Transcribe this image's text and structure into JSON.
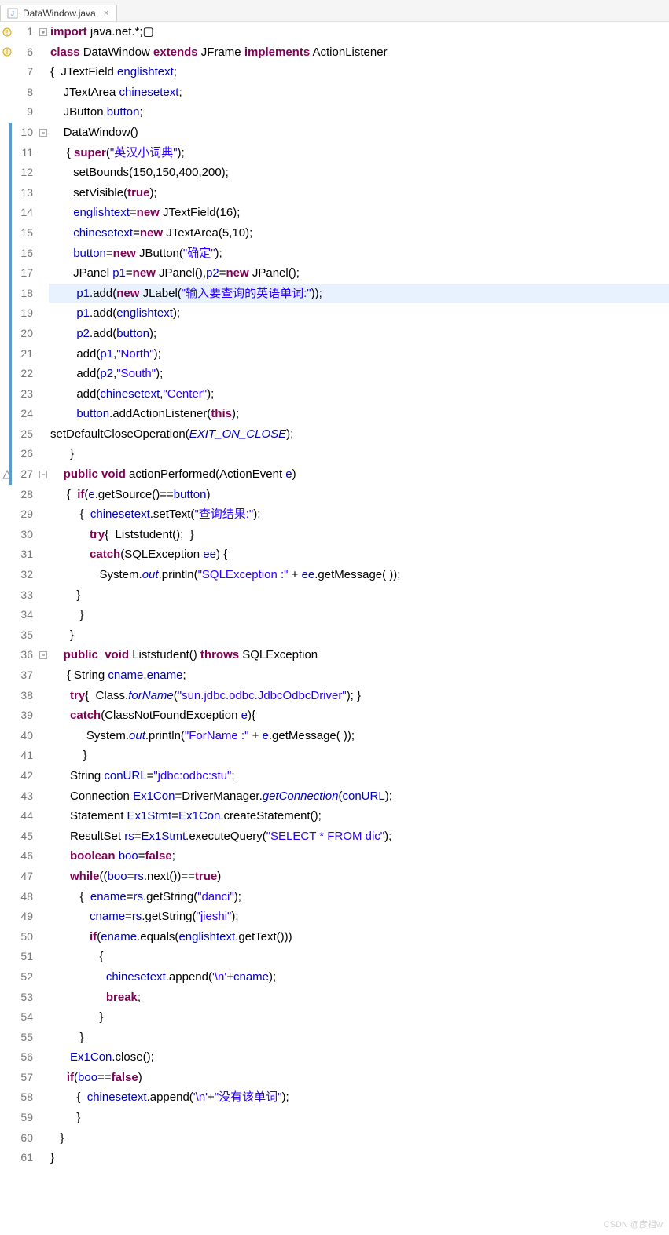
{
  "tab": {
    "filename": "DataWindow.java",
    "close": "×"
  },
  "gutter_icons": {
    "warning": "⚠",
    "fold_plus": "⊕",
    "fold_minus": "⊖",
    "override": "△"
  },
  "lines": [
    {
      "n": 1,
      "g": "warning",
      "f": "plus",
      "changed": false,
      "hl": false,
      "html": "<span class='kw'>import</span> java.net.*;▢"
    },
    {
      "n": 6,
      "g": "warning",
      "f": "",
      "changed": false,
      "hl": false,
      "html": "<span class='kw'>class</span> DataWindow <span class='kw'>extends</span> JFrame <span class='kw'>implements</span> ActionListener"
    },
    {
      "n": 7,
      "g": "",
      "f": "",
      "changed": false,
      "hl": false,
      "html": "{  JTextField <span class='field'>englishtext</span>;"
    },
    {
      "n": 8,
      "g": "",
      "f": "",
      "changed": false,
      "hl": false,
      "html": "    JTextArea <span class='field'>chinesetext</span>;"
    },
    {
      "n": 9,
      "g": "",
      "f": "",
      "changed": false,
      "hl": false,
      "html": "    JButton <span class='field'>button</span>;"
    },
    {
      "n": 10,
      "g": "",
      "f": "minus",
      "changed": true,
      "hl": false,
      "html": "    DataWindow()"
    },
    {
      "n": 11,
      "g": "",
      "f": "",
      "changed": true,
      "hl": false,
      "html": "     { <span class='kw'>super</span>(<span class='str'>\"英汉小词典\"</span>);"
    },
    {
      "n": 12,
      "g": "",
      "f": "",
      "changed": true,
      "hl": false,
      "html": "       setBounds(150,150,400,200);"
    },
    {
      "n": 13,
      "g": "",
      "f": "",
      "changed": true,
      "hl": false,
      "html": "       setVisible(<span class='kw'>true</span>);"
    },
    {
      "n": 14,
      "g": "",
      "f": "",
      "changed": true,
      "hl": false,
      "html": "       <span class='field'>englishtext</span>=<span class='kw'>new</span> JTextField(16);"
    },
    {
      "n": 15,
      "g": "",
      "f": "",
      "changed": true,
      "hl": false,
      "html": "       <span class='field'>chinesetext</span>=<span class='kw'>new</span> JTextArea(5,10);"
    },
    {
      "n": 16,
      "g": "",
      "f": "",
      "changed": true,
      "hl": false,
      "html": "       <span class='field'>button</span>=<span class='kw'>new</span> JButton(<span class='str'>\"确定\"</span>);"
    },
    {
      "n": 17,
      "g": "",
      "f": "",
      "changed": true,
      "hl": false,
      "html": "       JPanel <span class='field'>p1</span>=<span class='kw'>new</span> JPanel(),<span class='field'>p2</span>=<span class='kw'>new</span> JPanel();"
    },
    {
      "n": 18,
      "g": "",
      "f": "",
      "changed": true,
      "hl": true,
      "html": "        <span class='field'>p1</span>.add(<span class='kw'>new</span> JLabel(<span class='str'>\"输入要查询的英语单词:\"</span>));"
    },
    {
      "n": 19,
      "g": "",
      "f": "",
      "changed": true,
      "hl": false,
      "html": "        <span class='field'>p1</span>.add(<span class='field'>englishtext</span>);"
    },
    {
      "n": 20,
      "g": "",
      "f": "",
      "changed": true,
      "hl": false,
      "html": "        <span class='field'>p2</span>.add(<span class='field'>button</span>);"
    },
    {
      "n": 21,
      "g": "",
      "f": "",
      "changed": true,
      "hl": false,
      "html": "        add(<span class='field'>p1</span>,<span class='str'>\"North\"</span>);"
    },
    {
      "n": 22,
      "g": "",
      "f": "",
      "changed": true,
      "hl": false,
      "html": "        add(<span class='field'>p2</span>,<span class='str'>\"South\"</span>);"
    },
    {
      "n": 23,
      "g": "",
      "f": "",
      "changed": true,
      "hl": false,
      "html": "        add(<span class='field'>chinesetext</span>,<span class='str'>\"Center\"</span>);"
    },
    {
      "n": 24,
      "g": "",
      "f": "",
      "changed": true,
      "hl": false,
      "html": "        <span class='field'>button</span>.addActionListener(<span class='kw'>this</span>);"
    },
    {
      "n": 25,
      "g": "",
      "f": "",
      "changed": true,
      "hl": false,
      "html": "setDefaultCloseOperation(<span class='cstat'>EXIT_ON_CLOSE</span>);"
    },
    {
      "n": 26,
      "g": "",
      "f": "",
      "changed": true,
      "hl": false,
      "html": "      }"
    },
    {
      "n": 27,
      "g": "override",
      "f": "minus",
      "changed": true,
      "hl": false,
      "html": "    <span class='kw'>public</span> <span class='kw'>void</span> actionPerformed(ActionEvent <span class='field'>e</span>)"
    },
    {
      "n": 28,
      "g": "",
      "f": "",
      "changed": false,
      "hl": false,
      "html": "     {  <span class='kw'>if</span>(<span class='field'>e</span>.getSource()==<span class='field'>button</span>)"
    },
    {
      "n": 29,
      "g": "",
      "f": "",
      "changed": false,
      "hl": false,
      "html": "         {  <span class='field'>chinesetext</span>.setText(<span class='str'>\"查询结果:\"</span>);"
    },
    {
      "n": 30,
      "g": "",
      "f": "",
      "changed": false,
      "hl": false,
      "html": "            <span class='kw'>try</span>{  Liststudent();  }"
    },
    {
      "n": 31,
      "g": "",
      "f": "",
      "changed": false,
      "hl": false,
      "html": "            <span class='kw'>catch</span>(SQLException <span class='field'>ee</span>) {"
    },
    {
      "n": 32,
      "g": "",
      "f": "",
      "changed": false,
      "hl": false,
      "html": "               System.<span class='cstat'>out</span>.println(<span class='str'>\"SQLException :\"</span> + <span class='field'>ee</span>.getMessage( ));"
    },
    {
      "n": 33,
      "g": "",
      "f": "",
      "changed": false,
      "hl": false,
      "html": "        }"
    },
    {
      "n": 34,
      "g": "",
      "f": "",
      "changed": false,
      "hl": false,
      "html": "         }"
    },
    {
      "n": 35,
      "g": "",
      "f": "",
      "changed": false,
      "hl": false,
      "html": "      }"
    },
    {
      "n": 36,
      "g": "",
      "f": "minus",
      "changed": false,
      "hl": false,
      "html": "    <span class='kw'>public</span>  <span class='kw'>void</span> Liststudent() <span class='kw'>throws</span> SQLException"
    },
    {
      "n": 37,
      "g": "",
      "f": "",
      "changed": false,
      "hl": false,
      "html": "     { String <span class='field'>cname</span>,<span class='field'>ename</span>;"
    },
    {
      "n": 38,
      "g": "",
      "f": "",
      "changed": false,
      "hl": false,
      "html": "      <span class='kw'>try</span>{  Class.<span class='cstat'>forName</span>(<span class='str'>\"sun.jdbc.odbc.JdbcOdbcDriver\"</span>); }"
    },
    {
      "n": 39,
      "g": "",
      "f": "",
      "changed": false,
      "hl": false,
      "html": "      <span class='kw'>catch</span>(ClassNotFoundException <span class='field'>e</span>){"
    },
    {
      "n": 40,
      "g": "",
      "f": "",
      "changed": false,
      "hl": false,
      "html": "           System.<span class='cstat'>out</span>.println(<span class='str'>\"ForName :\"</span> + <span class='field'>e</span>.getMessage( ));"
    },
    {
      "n": 41,
      "g": "",
      "f": "",
      "changed": false,
      "hl": false,
      "html": "          }"
    },
    {
      "n": 42,
      "g": "",
      "f": "",
      "changed": false,
      "hl": false,
      "html": "      String <span class='field'>conURL</span>=<span class='str'>\"jdbc:odbc:stu\"</span>;"
    },
    {
      "n": 43,
      "g": "",
      "f": "",
      "changed": false,
      "hl": false,
      "html": "      Connection <span class='field'>Ex1Con</span>=DriverManager.<span class='cstat'>getConnection</span>(<span class='field'>conURL</span>);"
    },
    {
      "n": 44,
      "g": "",
      "f": "",
      "changed": false,
      "hl": false,
      "html": "      Statement <span class='field'>Ex1Stmt</span>=<span class='field'>Ex1Con</span>.createStatement();"
    },
    {
      "n": 45,
      "g": "",
      "f": "",
      "changed": false,
      "hl": false,
      "html": "      ResultSet <span class='field'>rs</span>=<span class='field'>Ex1Stmt</span>.executeQuery(<span class='str'>\"SELECT * FROM dic\"</span>);"
    },
    {
      "n": 46,
      "g": "",
      "f": "",
      "changed": false,
      "hl": false,
      "html": "      <span class='kw'>boolean</span> <span class='field'>boo</span>=<span class='kw'>false</span>;"
    },
    {
      "n": 47,
      "g": "",
      "f": "",
      "changed": false,
      "hl": false,
      "html": "      <span class='kw'>while</span>((<span class='field'>boo</span>=<span class='field'>rs</span>.next())==<span class='kw'>true</span>)"
    },
    {
      "n": 48,
      "g": "",
      "f": "",
      "changed": false,
      "hl": false,
      "html": "         {  <span class='field'>ename</span>=<span class='field'>rs</span>.getString(<span class='str'>\"danci\"</span>);"
    },
    {
      "n": 49,
      "g": "",
      "f": "",
      "changed": false,
      "hl": false,
      "html": "            <span class='field'>cname</span>=<span class='field'>rs</span>.getString(<span class='str'>\"jieshi\"</span>);"
    },
    {
      "n": 50,
      "g": "",
      "f": "",
      "changed": false,
      "hl": false,
      "html": "            <span class='kw'>if</span>(<span class='field'>ename</span>.equals(<span class='field'>englishtext</span>.getText()))"
    },
    {
      "n": 51,
      "g": "",
      "f": "",
      "changed": false,
      "hl": false,
      "html": "               {"
    },
    {
      "n": 52,
      "g": "",
      "f": "",
      "changed": false,
      "hl": false,
      "html": "                 <span class='field'>chinesetext</span>.append(<span class='str'>'\\n'</span>+<span class='field'>cname</span>);"
    },
    {
      "n": 53,
      "g": "",
      "f": "",
      "changed": false,
      "hl": false,
      "html": "                 <span class='kw'>break</span>;"
    },
    {
      "n": 54,
      "g": "",
      "f": "",
      "changed": false,
      "hl": false,
      "html": "               }"
    },
    {
      "n": 55,
      "g": "",
      "f": "",
      "changed": false,
      "hl": false,
      "html": "         }"
    },
    {
      "n": 56,
      "g": "",
      "f": "",
      "changed": false,
      "hl": false,
      "html": "      <span class='field'>Ex1Con</span>.close();"
    },
    {
      "n": 57,
      "g": "",
      "f": "",
      "changed": false,
      "hl": false,
      "html": "     <span class='kw'>if</span>(<span class='field'>boo</span>==<span class='kw'>false</span>)"
    },
    {
      "n": 58,
      "g": "",
      "f": "",
      "changed": false,
      "hl": false,
      "html": "        {  <span class='field'>chinesetext</span>.append(<span class='str'>'\\n'</span>+<span class='str'>\"没有该单词\"</span>);"
    },
    {
      "n": 59,
      "g": "",
      "f": "",
      "changed": false,
      "hl": false,
      "html": "        }"
    },
    {
      "n": 60,
      "g": "",
      "f": "",
      "changed": false,
      "hl": false,
      "html": "   }"
    },
    {
      "n": 61,
      "g": "",
      "f": "",
      "changed": false,
      "hl": false,
      "html": "}"
    }
  ],
  "watermark": "CSDN @彦祖w"
}
